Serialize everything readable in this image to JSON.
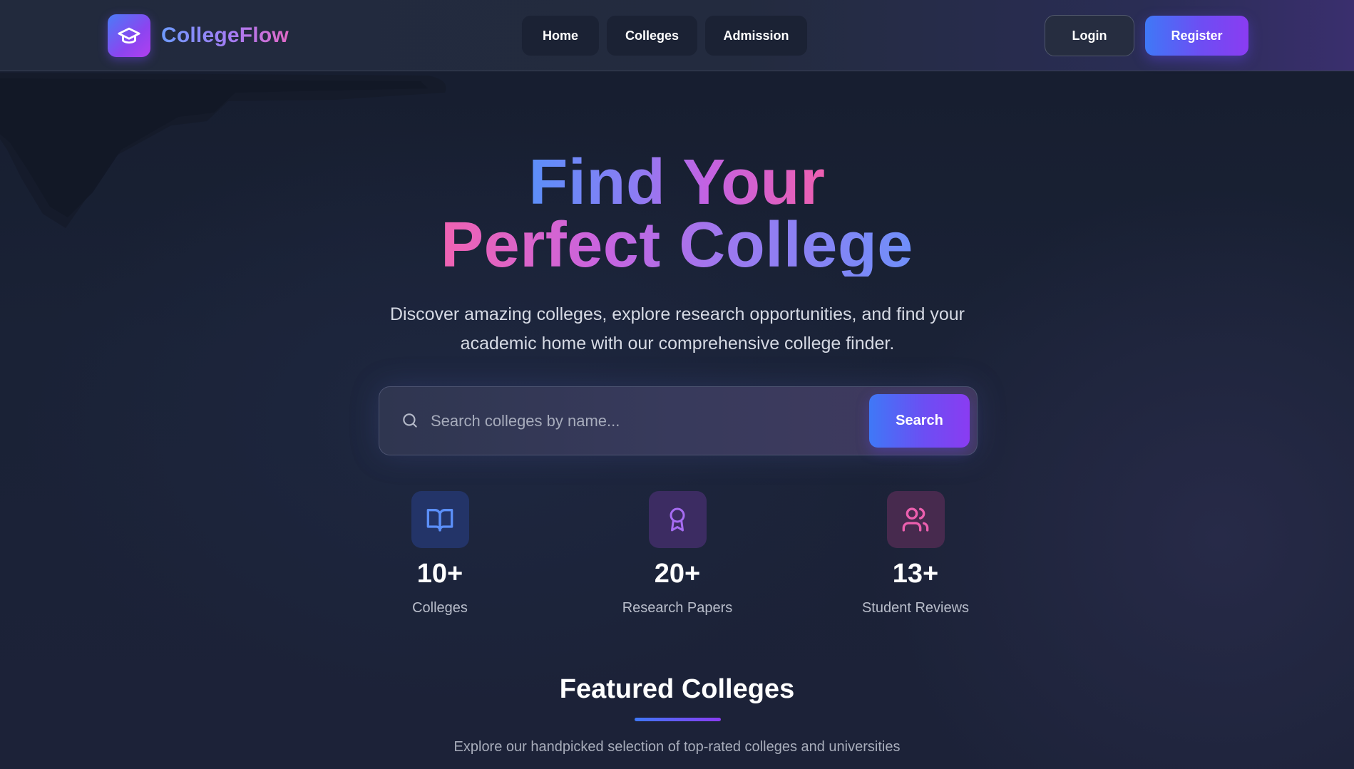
{
  "brand": {
    "name": "CollegeFlow",
    "icon": "graduation-cap-icon",
    "accent_from": "#4a7cf7",
    "accent_to": "#b13ff0"
  },
  "nav": {
    "items": [
      {
        "label": "Home"
      },
      {
        "label": "Colleges"
      },
      {
        "label": "Admission"
      }
    ]
  },
  "auth": {
    "login_label": "Login",
    "register_label": "Register"
  },
  "hero": {
    "title_line1": "Find Your",
    "title_line2": "Perfect College",
    "subtitle": "Discover amazing colleges, explore research opportunities, and find your academic home with our comprehensive college finder."
  },
  "search": {
    "placeholder": "Search colleges by name...",
    "value": "",
    "button_label": "Search",
    "icon": "search-icon"
  },
  "stats": [
    {
      "icon": "book-open-icon",
      "value": "10+",
      "label": "Colleges",
      "color": "#5b8ff9"
    },
    {
      "icon": "award-icon",
      "value": "20+",
      "label": "Research Papers",
      "color": "#a66cf2"
    },
    {
      "icon": "users-icon",
      "value": "13+",
      "label": "Student Reviews",
      "color": "#ec5fae"
    }
  ],
  "featured": {
    "title": "Featured Colleges",
    "subtitle": "Explore our handpicked selection of top-rated colleges and universities"
  }
}
